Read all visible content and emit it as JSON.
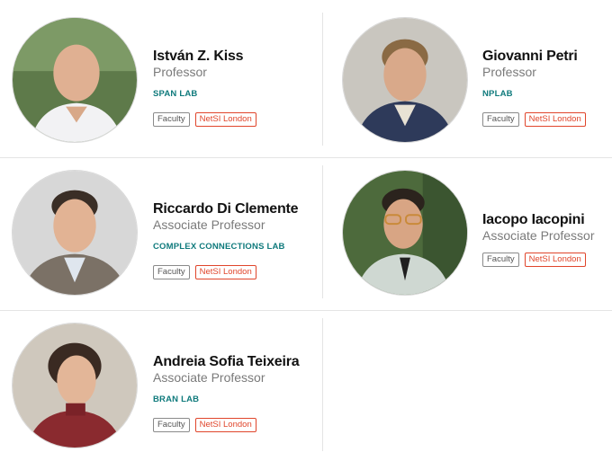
{
  "people": [
    {
      "name": "István Z. Kiss",
      "role": "Professor",
      "lab": "SPAN LAB",
      "tags": [
        "Faculty",
        "NetSI London"
      ]
    },
    {
      "name": "Giovanni Petri",
      "role": "Professor",
      "lab": "NPLAB",
      "tags": [
        "Faculty",
        "NetSI London"
      ]
    },
    {
      "name": "Riccardo Di Clemente",
      "role": "Associate Professor",
      "lab": "COMPLEX CONNECTIONS LAB",
      "tags": [
        "Faculty",
        "NetSI London"
      ]
    },
    {
      "name": "Iacopo Iacopini",
      "role": "Associate Professor",
      "lab": "",
      "tags": [
        "Faculty",
        "NetSI London"
      ]
    },
    {
      "name": "Andreia Sofia Teixeira",
      "role": "Associate Professor",
      "lab": "BRAN LAB",
      "tags": [
        "Faculty",
        "NetSI London"
      ]
    }
  ],
  "colors": {
    "lab": "#0f7a7c",
    "location_tag": "#e0452b",
    "faculty_tag": "#8a8a8a"
  }
}
